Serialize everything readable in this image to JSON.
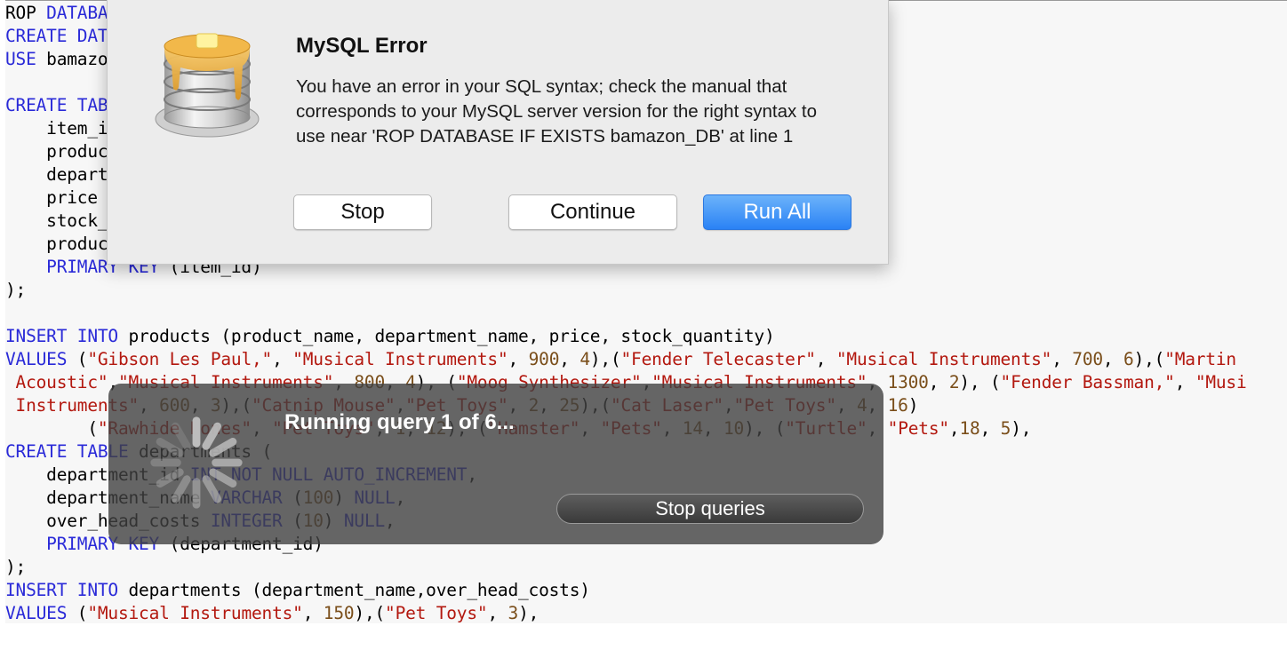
{
  "editor": {
    "lines": [
      [
        {
          "t": "tx",
          "v": "ROP "
        },
        {
          "t": "kw",
          "v": "DATABA"
        }
      ],
      [
        {
          "t": "kw",
          "v": "CREATE DAT"
        }
      ],
      [
        {
          "t": "kw",
          "v": "USE"
        },
        {
          "t": "tx",
          "v": " bamazo"
        }
      ],
      [],
      [
        {
          "t": "kw",
          "v": "CREATE TAB"
        }
      ],
      [
        {
          "t": "tx",
          "v": "    item_i"
        }
      ],
      [
        {
          "t": "tx",
          "v": "    produc"
        }
      ],
      [
        {
          "t": "tx",
          "v": "    depart"
        }
      ],
      [
        {
          "t": "tx",
          "v": "    price "
        }
      ],
      [
        {
          "t": "tx",
          "v": "    stock_"
        }
      ],
      [
        {
          "t": "tx",
          "v": "    produc"
        }
      ],
      [
        {
          "t": "kw",
          "v": "    PRIMARY KEY"
        },
        {
          "t": "tx",
          "v": " (item_id)"
        }
      ],
      [
        {
          "t": "tx",
          "v": ");"
        }
      ],
      [],
      [
        {
          "t": "kw",
          "v": "INSERT INTO"
        },
        {
          "t": "tx",
          "v": " products (product_name, department_name, price, stock_quantity)"
        }
      ],
      [
        {
          "t": "kw",
          "v": "VALUES"
        },
        {
          "t": "tx",
          "v": " ("
        },
        {
          "t": "str",
          "v": "\"Gibson Les Paul,\""
        },
        {
          "t": "tx",
          "v": ", "
        },
        {
          "t": "str",
          "v": "\"Musical Instruments\""
        },
        {
          "t": "tx",
          "v": ", "
        },
        {
          "t": "num",
          "v": "900"
        },
        {
          "t": "tx",
          "v": ", "
        },
        {
          "t": "num",
          "v": "4"
        },
        {
          "t": "tx",
          "v": "),("
        },
        {
          "t": "str",
          "v": "\"Fender Telecaster\""
        },
        {
          "t": "tx",
          "v": ", "
        },
        {
          "t": "str",
          "v": "\"Musical Instruments\""
        },
        {
          "t": "tx",
          "v": ", "
        },
        {
          "t": "num",
          "v": "700"
        },
        {
          "t": "tx",
          "v": ", "
        },
        {
          "t": "num",
          "v": "6"
        },
        {
          "t": "tx",
          "v": "),("
        },
        {
          "t": "str",
          "v": "\"Martin"
        }
      ],
      [
        {
          "t": "str",
          "v": " Acoustic\""
        },
        {
          "t": "tx",
          "v": ","
        },
        {
          "t": "str",
          "v": "\"Musical Instruments\""
        },
        {
          "t": "tx",
          "v": ", "
        },
        {
          "t": "num",
          "v": "800"
        },
        {
          "t": "tx",
          "v": ", "
        },
        {
          "t": "num",
          "v": "4"
        },
        {
          "t": "tx",
          "v": "), ("
        },
        {
          "t": "str",
          "v": "\"Moog Synthesizer\""
        },
        {
          "t": "tx",
          "v": ","
        },
        {
          "t": "str",
          "v": "\"Musical Instruments\""
        },
        {
          "t": "tx",
          "v": ", "
        },
        {
          "t": "num",
          "v": "1300"
        },
        {
          "t": "tx",
          "v": ", "
        },
        {
          "t": "num",
          "v": "2"
        },
        {
          "t": "tx",
          "v": "), ("
        },
        {
          "t": "str",
          "v": "\"Fender Bassman,\""
        },
        {
          "t": "tx",
          "v": ", "
        },
        {
          "t": "str",
          "v": "\"Musi"
        }
      ],
      [
        {
          "t": "str",
          "v": " Instruments\""
        },
        {
          "t": "tx",
          "v": ", "
        },
        {
          "t": "num",
          "v": "600"
        },
        {
          "t": "tx",
          "v": ", "
        },
        {
          "t": "num",
          "v": "3"
        },
        {
          "t": "tx",
          "v": "),("
        },
        {
          "t": "str",
          "v": "\"Catnip Mouse\""
        },
        {
          "t": "tx",
          "v": ","
        },
        {
          "t": "str",
          "v": "\"Pet Toys\""
        },
        {
          "t": "tx",
          "v": ", "
        },
        {
          "t": "num",
          "v": "2"
        },
        {
          "t": "tx",
          "v": ", "
        },
        {
          "t": "num",
          "v": "25"
        },
        {
          "t": "tx",
          "v": "),("
        },
        {
          "t": "str",
          "v": "\"Cat Laser\""
        },
        {
          "t": "tx",
          "v": ","
        },
        {
          "t": "str",
          "v": "\"Pet Toys\""
        },
        {
          "t": "tx",
          "v": ", "
        },
        {
          "t": "num",
          "v": "4"
        },
        {
          "t": "tx",
          "v": ", "
        },
        {
          "t": "num",
          "v": "16"
        },
        {
          "t": "tx",
          "v": ")"
        }
      ],
      [
        {
          "t": "tx",
          "v": "        ("
        },
        {
          "t": "str",
          "v": "\"Rawhide Bones\""
        },
        {
          "t": "tx",
          "v": ", "
        },
        {
          "t": "str",
          "v": "\"Pet Toys\""
        },
        {
          "t": "tx",
          "v": ", "
        },
        {
          "t": "num",
          "v": "1"
        },
        {
          "t": "tx",
          "v": ", "
        },
        {
          "t": "num",
          "v": "12"
        },
        {
          "t": "tx",
          "v": "), ("
        },
        {
          "t": "str",
          "v": "\"Hamster\""
        },
        {
          "t": "tx",
          "v": ", "
        },
        {
          "t": "str",
          "v": "\"Pets\""
        },
        {
          "t": "tx",
          "v": ", "
        },
        {
          "t": "num",
          "v": "14"
        },
        {
          "t": "tx",
          "v": ", "
        },
        {
          "t": "num",
          "v": "10"
        },
        {
          "t": "tx",
          "v": "), ("
        },
        {
          "t": "str",
          "v": "\"Turtle\""
        },
        {
          "t": "tx",
          "v": ", "
        },
        {
          "t": "str",
          "v": "\"Pets\""
        },
        {
          "t": "tx",
          "v": ","
        },
        {
          "t": "num",
          "v": "18"
        },
        {
          "t": "tx",
          "v": ", "
        },
        {
          "t": "num",
          "v": "5"
        },
        {
          "t": "tx",
          "v": "),"
        }
      ],
      [
        {
          "t": "kw",
          "v": "CREATE TABLE"
        },
        {
          "t": "tx",
          "v": " departments ("
        }
      ],
      [
        {
          "t": "tx",
          "v": "    department_id "
        },
        {
          "t": "kw",
          "v": "INT NOT NULL AUTO_INCREMENT"
        },
        {
          "t": "tx",
          "v": ","
        }
      ],
      [
        {
          "t": "tx",
          "v": "    department_name "
        },
        {
          "t": "kw",
          "v": "VARCHAR"
        },
        {
          "t": "tx",
          "v": " ("
        },
        {
          "t": "num",
          "v": "100"
        },
        {
          "t": "tx",
          "v": ") "
        },
        {
          "t": "kw",
          "v": "NULL"
        },
        {
          "t": "tx",
          "v": ","
        }
      ],
      [
        {
          "t": "tx",
          "v": "    over_head_costs "
        },
        {
          "t": "kw",
          "v": "INTEGER"
        },
        {
          "t": "tx",
          "v": " ("
        },
        {
          "t": "num",
          "v": "10"
        },
        {
          "t": "tx",
          "v": ") "
        },
        {
          "t": "kw",
          "v": "NULL"
        },
        {
          "t": "tx",
          "v": ","
        }
      ],
      [
        {
          "t": "kw",
          "v": "    PRIMARY KEY"
        },
        {
          "t": "tx",
          "v": " (department_id)"
        }
      ],
      [
        {
          "t": "tx",
          "v": ");"
        }
      ],
      [
        {
          "t": "kw",
          "v": "INSERT INTO"
        },
        {
          "t": "tx",
          "v": " departments (department_name,over_head_costs)"
        }
      ],
      [
        {
          "t": "kw",
          "v": "VALUES"
        },
        {
          "t": "tx",
          "v": " ("
        },
        {
          "t": "str",
          "v": "\"Musical Instruments\""
        },
        {
          "t": "tx",
          "v": ", "
        },
        {
          "t": "num",
          "v": "150"
        },
        {
          "t": "tx",
          "v": "),("
        },
        {
          "t": "str",
          "v": "\"Pet Toys\""
        },
        {
          "t": "tx",
          "v": ", "
        },
        {
          "t": "num",
          "v": "3"
        },
        {
          "t": "tx",
          "v": "),"
        }
      ]
    ]
  },
  "error_dialog": {
    "icon": "sequel-pro-database-icon",
    "title": "MySQL Error",
    "message": "You have an error in your SQL syntax; check the manual that corresponds to your MySQL server version for the right syntax to use near 'ROP DATABASE IF EXISTS bamazon_DB' at line 1",
    "buttons": {
      "stop": "Stop",
      "continue": "Continue",
      "run_all": "Run All"
    }
  },
  "progress_hud": {
    "icon": "spinner-icon",
    "text": "Running query 1 of 6...",
    "stop_button": "Stop queries"
  }
}
